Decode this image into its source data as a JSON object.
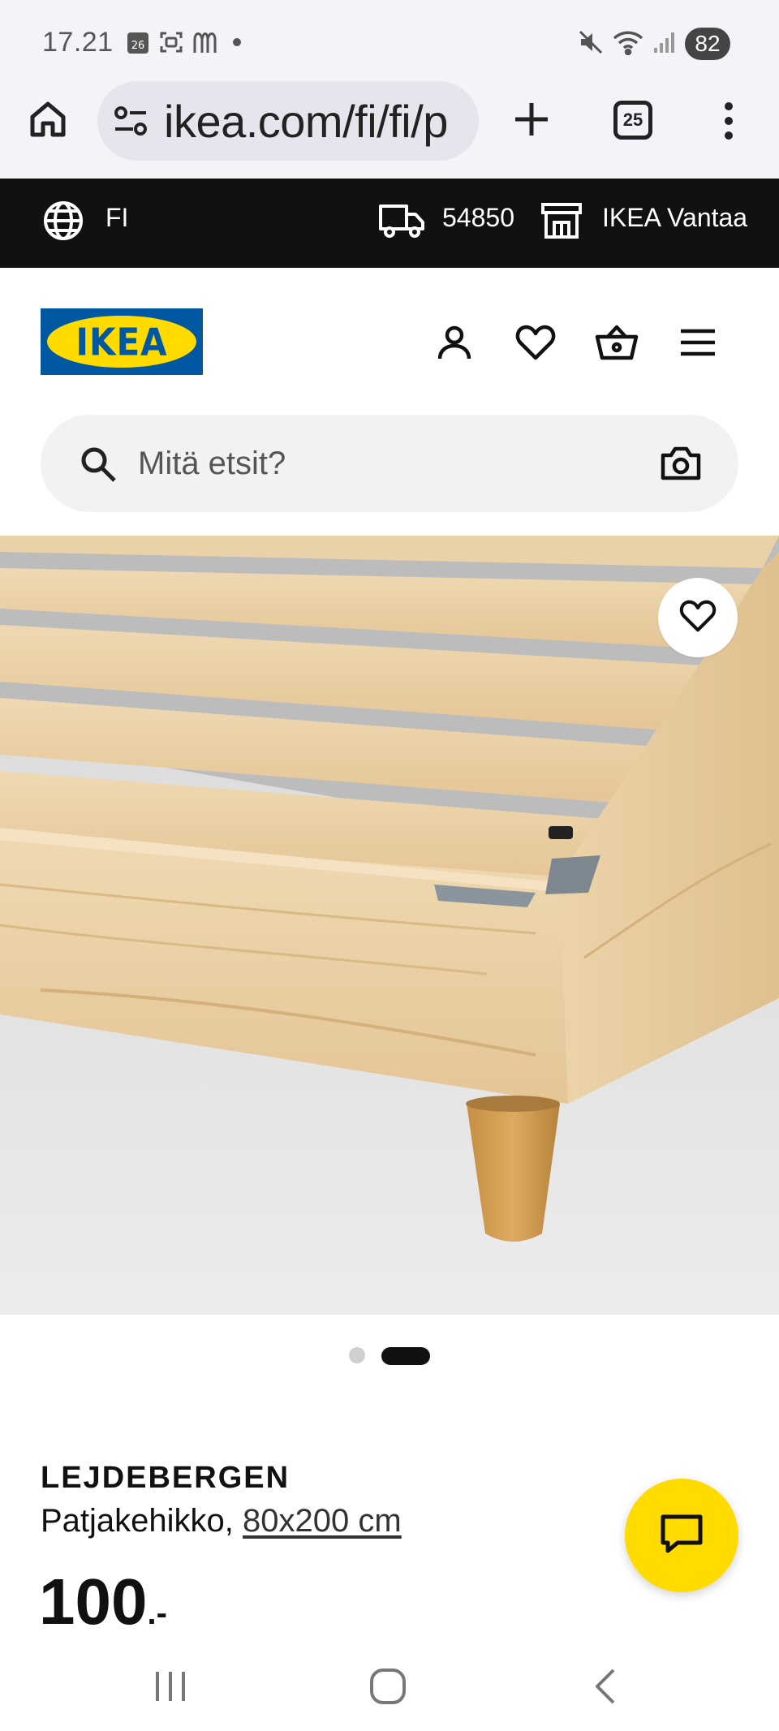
{
  "status_bar": {
    "time": "17.21",
    "calendar_day": "26",
    "battery": "82",
    "icons": [
      "calendar-icon",
      "screenshot-icon",
      "mcdonalds-icon",
      "dot-icon",
      "mute-icon",
      "wifi-icon",
      "signal-icon"
    ]
  },
  "browser": {
    "url": "ikea.com/fi/fi/p",
    "tab_count": "25",
    "icons": [
      "home-icon",
      "site-settings-icon",
      "new-tab-icon",
      "tabs-icon",
      "more-icon"
    ]
  },
  "top_strip": {
    "language": "FI",
    "postal_code": "54850",
    "store": "IKEA Vantaa"
  },
  "header": {
    "logo_text": "IKEA",
    "icons": [
      "account-icon",
      "wishlist-icon",
      "basket-icon",
      "menu-icon"
    ]
  },
  "search": {
    "placeholder": "Mitä etsit?"
  },
  "carousel": {
    "total": 2,
    "active": 2
  },
  "product": {
    "name": "LEJDEBERGEN",
    "description": "Patjakehikko,",
    "size": "80x200 cm",
    "price": "100",
    "price_suffix": ".-"
  },
  "colors": {
    "ikea_blue": "#0058a3",
    "ikea_yellow": "#ffdb00",
    "strip_black": "#111111",
    "browser_bg": "#f4f3f8"
  }
}
